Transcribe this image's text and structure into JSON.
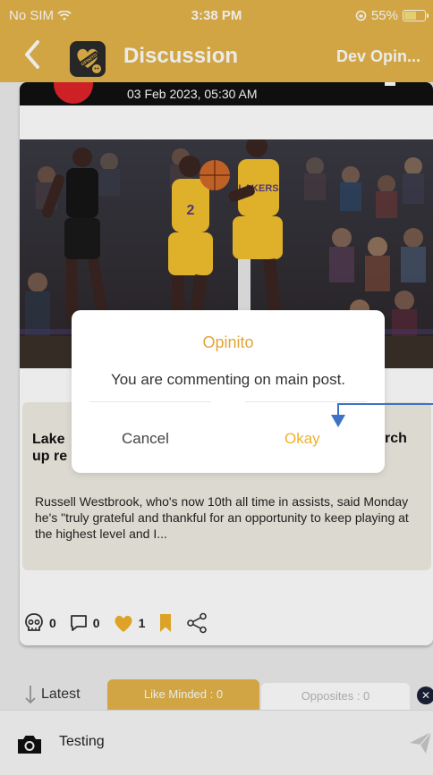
{
  "status_bar": {
    "carrier": "No SIM",
    "time": "3:38 PM",
    "battery": "55%",
    "battery_level": 0.55
  },
  "navbar": {
    "back_icon": "chevron-left-icon",
    "logo_text": "OPINITO",
    "title": "Discussion",
    "right_label": "Dev Opin..."
  },
  "post": {
    "date": "03 Feb 2023, 05:30 AM",
    "article_title_peek_left": "Lake",
    "article_title_peek_left2": "up re",
    "article_title_peek_right": "rch",
    "article_body": "Russell Westbrook, who's now 10th all time in assists, said Monday he's \"truly grateful and thankful for an opportunity to keep playing at the highest level and I...",
    "actions": {
      "skull_count": "0",
      "comment_count": "0",
      "heart_count": "1"
    }
  },
  "dialog": {
    "title": "Opinito",
    "message": "You are commenting on main post.",
    "cancel_label": "Cancel",
    "okay_label": "Okay"
  },
  "tabs": {
    "latest": "Latest",
    "like_minded": "Like Minded : 0",
    "opposites": "Opposites : 0"
  },
  "composer": {
    "text": "Testing"
  },
  "colors": {
    "accent": "#E3B44A",
    "okay": "#F0B12A",
    "annotation_arrow": "#3D72C6"
  }
}
